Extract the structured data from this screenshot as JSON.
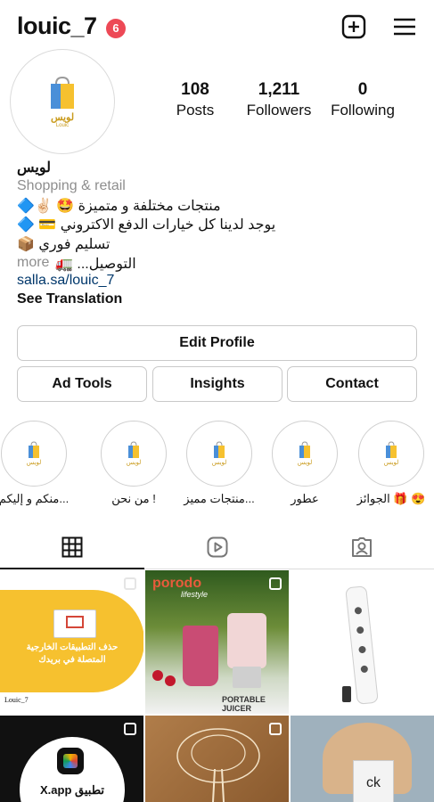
{
  "header": {
    "username": "louic_7",
    "notif_count": "6"
  },
  "stats": [
    {
      "value": "108",
      "label": "Posts"
    },
    {
      "value": "1,211",
      "label": "Followers"
    },
    {
      "value": "0",
      "label": "Following"
    }
  ],
  "profile": {
    "name": "لويس",
    "category": "Shopping & retail",
    "bio": [
      "منتجات مختلفة و متميزة 🤩 ✌🏻🔷",
      "يوجد لدينا كل خيارات الدفع الاكتروني 💳 🔷",
      "تسليم فوري 📦",
      "التوصيل... 🚛"
    ],
    "more": "more",
    "link": "salla.sa/louic_7",
    "see_translation": "See Translation",
    "avatar_text": "لويس"
  },
  "buttons": {
    "edit": "Edit Profile",
    "ad_tools": "Ad Tools",
    "insights": "Insights",
    "contact": "Contact"
  },
  "highlights": [
    {
      "label": "منكم و إليكم...",
      "logo_text": "لويس"
    },
    {
      "label": "من نحن !",
      "logo_text": "لويس"
    },
    {
      "label": "منتجات مميز...",
      "logo_text": "لويس"
    },
    {
      "label": "عطور",
      "logo_text": "لويس"
    },
    {
      "label": "الجوائز 🎁 😍",
      "logo_text": "لويس"
    }
  ],
  "posts": {
    "p1_text": "حذف التطبيقات الخارجية المتصلة في بريدك",
    "p1_tag": "Louic_7",
    "p2_brand": "porodo",
    "p2_sub": "lifestyle",
    "p2_title": "PORTABLE JUICER",
    "p4_text": "تطبيق X.app",
    "p6_text": "ck"
  },
  "colors": {
    "brand_yellow": "#f6c12f",
    "badge_red": "#ed4956",
    "link_blue": "#00376b"
  }
}
